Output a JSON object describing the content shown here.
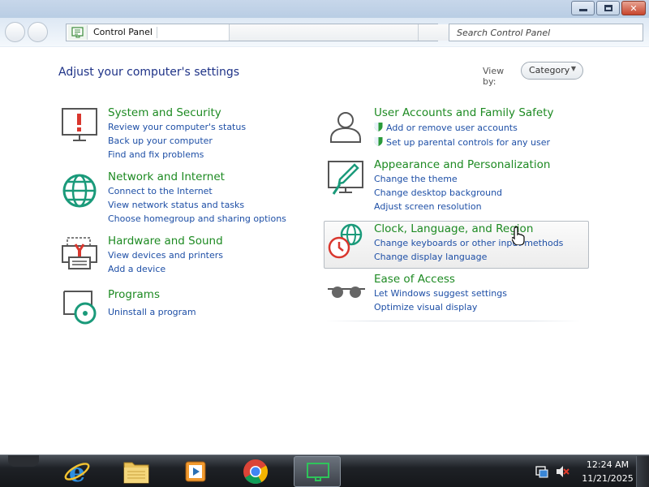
{
  "window": {
    "controls": {
      "minimize": "minimize",
      "maximize": "maximize",
      "close": "✕"
    }
  },
  "address_bar": {
    "crumb": "Control Panel"
  },
  "search": {
    "placeholder": "Search Control Panel"
  },
  "main": {
    "heading": "Adjust your computer's settings",
    "view_by": {
      "label": "View by:",
      "selected": "Category"
    }
  },
  "categories": [
    {
      "icon": "security-monitor-icon",
      "title": "System and Security",
      "links": [
        "Review your computer's status",
        "Back up your computer",
        "Find and fix problems"
      ]
    },
    {
      "icon": "network-globe-icon",
      "title": "Network and Internet",
      "links": [
        "Connect to the Internet",
        "View network status and tasks",
        "Choose homegroup and sharing options"
      ]
    },
    {
      "icon": "printer-icon",
      "title": "Hardware and Sound",
      "links": [
        "View devices and printers",
        "Add a device"
      ]
    },
    {
      "icon": "programs-disc-icon",
      "title": "Programs",
      "links": [
        "Uninstall a program"
      ]
    },
    {
      "icon": "users-icon",
      "title": "User Accounts and Family Safety",
      "links": [
        "Add or remove user accounts",
        "Set up parental controls for any user"
      ]
    },
    {
      "icon": "paintbrush-monitor-icon",
      "title": "Appearance and Personalization",
      "links": [
        "Change the theme",
        "Change desktop background",
        "Adjust screen resolution"
      ]
    },
    {
      "icon": "clock-globe-icon",
      "title": "Clock, Language, and Region",
      "links": [
        "Change keyboards or other input methods",
        "Change display language"
      ]
    },
    {
      "icon": "ease-of-access-glasses-icon",
      "title": "Ease of Access",
      "links": [
        "Let Windows suggest settings",
        "Optimize visual display"
      ]
    }
  ],
  "taskbar": {
    "apps": [
      "internet-explorer-icon",
      "file-explorer-icon",
      "media-player-icon",
      "chrome-icon",
      "control-panel-icon"
    ],
    "clock": {
      "time": "12:24 AM",
      "date": "11/21/2025"
    }
  },
  "colors": {
    "category_title": "#1d8a22",
    "link": "#1e4fa6",
    "heading": "#1e3287",
    "taskbar": "#1e2126"
  }
}
